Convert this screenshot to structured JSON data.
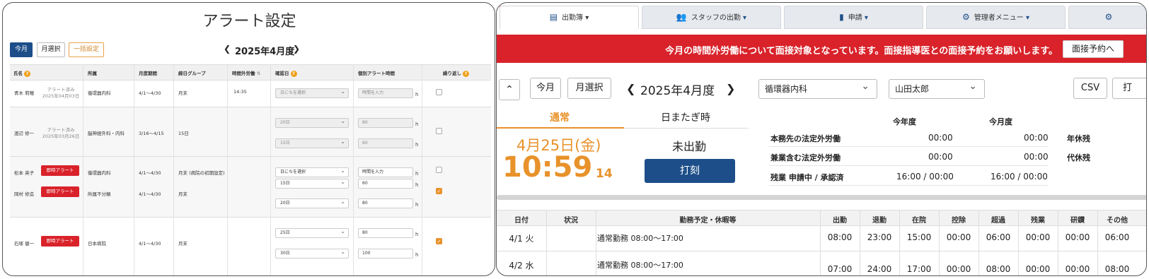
{
  "left": {
    "title": "アラート設定",
    "toolbar": {
      "this_month": "今月",
      "select_month": "月選択",
      "bulk": "一括設定"
    },
    "period": "2025年4月度",
    "headers": [
      "氏名",
      "所属",
      "月度期間",
      "締日グループ",
      "時間外労働",
      "確認日",
      "個別アラート時間",
      "繰り返し"
    ],
    "rows": [
      {
        "name": "青木 莉穂",
        "status": "アラート済み",
        "date": "2025年04月03日",
        "dept": "循環器内科",
        "period": "4/1〜4/30",
        "group": "月末",
        "overtime": "14:35",
        "day1": "日にちを選択",
        "hour1": "時間を入力"
      },
      {
        "name": "渡辺 修一",
        "status": "アラート済み",
        "date": "2025年03月26日",
        "dept": "脳神経外科・内科",
        "period": "3/16〜4/15",
        "group": "15日",
        "day1": "20日",
        "hour1": "80",
        "day2": "15日",
        "hour2": "60"
      },
      {
        "name": "松本 英子",
        "button": "即時アラート",
        "dept": "循環器内科",
        "period": "4/1〜4/30",
        "group": "月末 (病院の初期設定)",
        "day1": "日にちを選択",
        "hour1": "時間を入力"
      },
      {
        "name": "岡村 修造",
        "button": "即時アラート",
        "dept": "所属不分類",
        "period": "4/1〜4/30",
        "group": "月末",
        "day1": "15日",
        "hour1": "60",
        "day2": "20日",
        "hour2": "80"
      },
      {
        "name": "石塚 健一",
        "button": "即時アラート",
        "dept": "日本病院",
        "period": "4/1〜4/30",
        "group": "月末",
        "day1": "25日",
        "hour1": "80",
        "day2": "30日",
        "hour2": "100"
      }
    ],
    "unit": "h"
  },
  "right": {
    "tabs": [
      "出勤簿",
      "スタッフの出勤",
      "申請",
      "管理者メニュー"
    ],
    "banner": "今月の時間外労働について面接対象となっています。面接指導医との面接予約をお願いします。",
    "banner_button": "面接予約へ",
    "toolbar": {
      "collapse": "^",
      "this_month": "今月",
      "select_month": "月選択",
      "period": "2025年4月度",
      "dept": "循環器内科",
      "staff": "山田太郎",
      "csv": "CSV",
      "print_partial": "打"
    },
    "mode_tabs": [
      "通常",
      "日またぎ時"
    ],
    "date": "4月25日(金)",
    "time_hm": "10:59",
    "time_s": "14",
    "status": "未出勤",
    "punch": "打刻",
    "summary": {
      "cols": [
        "今年度",
        "今月度"
      ],
      "rows": [
        {
          "label": "本務先の法定外労働",
          "year": "00:00",
          "month": "00:00"
        },
        {
          "label": "兼業含む法定外労働",
          "year": "00:00",
          "month": "00:00"
        },
        {
          "label": "残業 申請中 / 承認済",
          "year": "16:00 / 00:00",
          "month": "16:00 / 00:00"
        }
      ],
      "side": [
        "年休残",
        "代休残"
      ]
    },
    "grid_headers": [
      "日付",
      "状況",
      "勤務予定・休暇等",
      "出勤",
      "退勤",
      "在院",
      "控除",
      "超過",
      "残業",
      "研鑽",
      "その他"
    ],
    "grid_rows": [
      {
        "date": "4/1 火",
        "status": "",
        "plan": "通常勤務 08:00〜17:00",
        "in": "08:00",
        "out": "23:00",
        "stay": "15:00",
        "deduct": "00:00",
        "over": "06:00",
        "ot": "00:00",
        "study": "00:00",
        "other": "06:00"
      },
      {
        "date": "4/2 水",
        "status": "",
        "plan": "通常勤務 08:00〜17:00",
        "in": "07:00",
        "out": "24:00",
        "stay": "17:00",
        "deduct": "00:00",
        "over": "08:00",
        "ot": "00:00",
        "study": "00:00",
        "other": "08:00"
      }
    ]
  }
}
